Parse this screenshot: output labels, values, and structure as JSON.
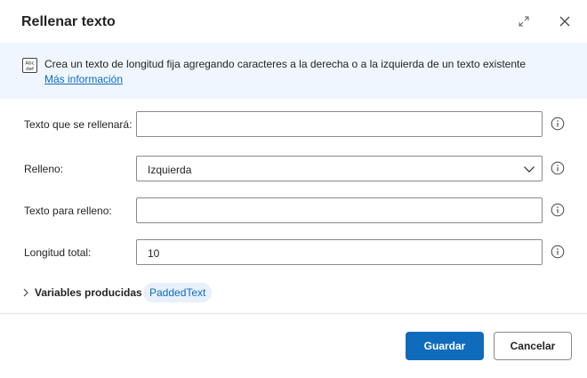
{
  "dialog": {
    "title": "Rellenar texto"
  },
  "info": {
    "description": "Crea un texto de longitud fija agregando caracteres a la derecha o a la izquierda de un texto existente",
    "link": "Más información"
  },
  "fields": {
    "text_to_pad": {
      "label": "Texto que se rellenará:",
      "value": ""
    },
    "padding": {
      "label": "Relleno:",
      "value": "Izquierda"
    },
    "pad_text": {
      "label": "Texto para relleno:",
      "value": ""
    },
    "total_length": {
      "label": "Longitud total:",
      "value": "10"
    }
  },
  "variables": {
    "label": "Variables producidas",
    "items": [
      "PaddedText"
    ]
  },
  "footer": {
    "save_label": "Guardar",
    "cancel_label": "Cancelar"
  },
  "colors": {
    "accent": "#0f6cbd",
    "banner_bg": "#f0f6ff",
    "chip_bg": "#e8f0fb"
  },
  "icons": {
    "expand": "expand-icon",
    "close": "close-icon",
    "info_banner": "text-abc-icon",
    "help": "info-circle-icon",
    "dropdown": "chevron-down-icon",
    "section_toggle": "chevron-right-icon"
  }
}
